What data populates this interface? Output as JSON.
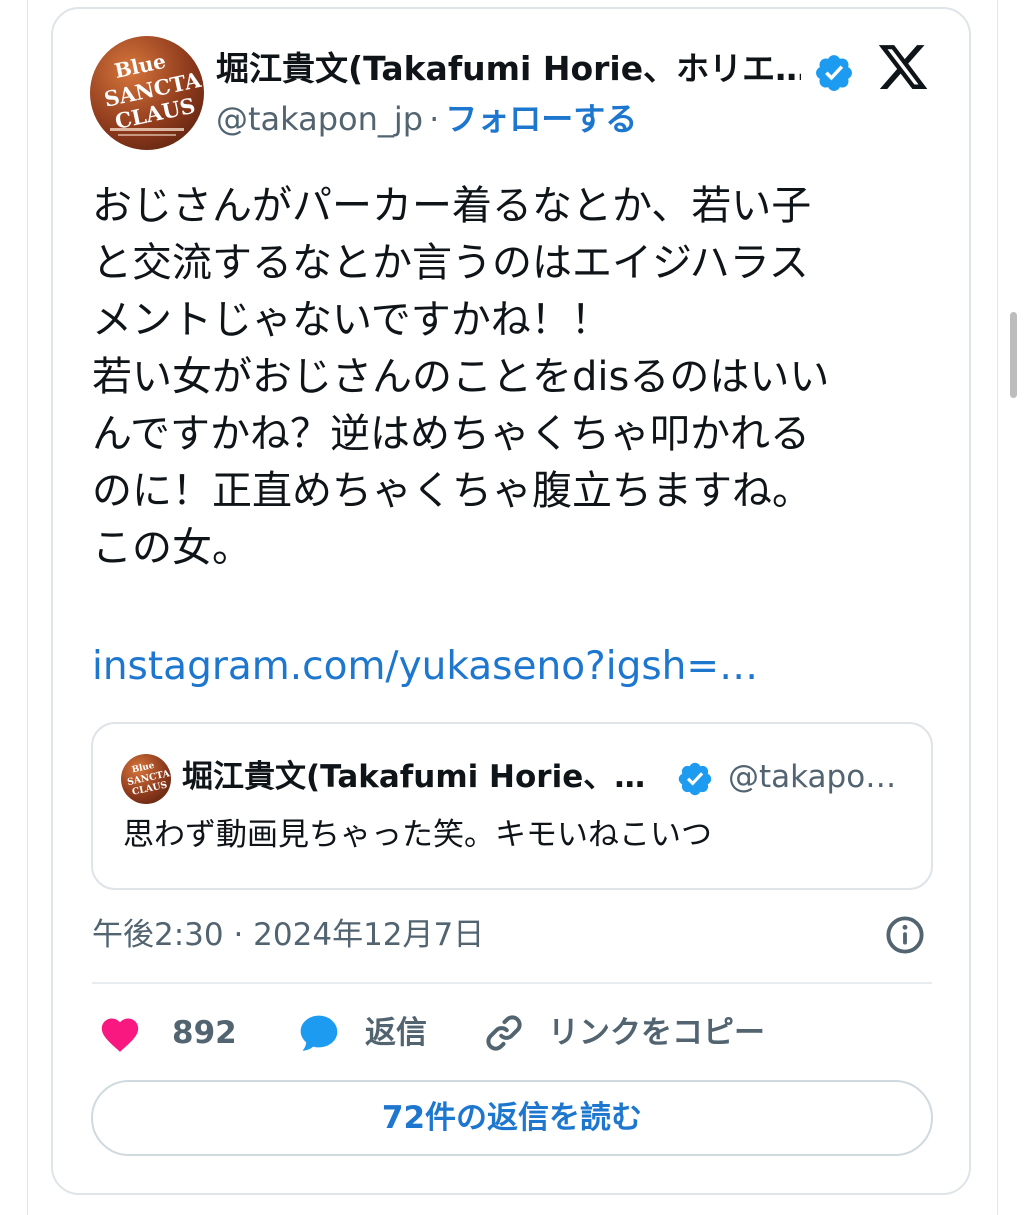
{
  "tweet": {
    "author_name": "堀江貴文(Takafumi Horie、ホリエ…",
    "handle": "@takapon_jp",
    "separator": "·",
    "follow_label": "フォローする",
    "body_lines": [
      "おじさんがパーカー着るなとか、若い子",
      "と交流するなとか言うのはエイジハラス",
      "メントじゃないですかね！！",
      "若い女がおじさんのことをdisるのはいい",
      "んですかね？逆はめちゃくちゃ叩かれる",
      "のに！正直めちゃくちゃ腹立ちますね。",
      "この女。"
    ],
    "link_text": "instagram.com/yukaseno?igsh=…",
    "timestamp": "午後2:30 · 2024年12月7日"
  },
  "quote": {
    "author_name": "堀江貴文(Takafumi Horie、…",
    "handle": "@takapo…",
    "text": "思わず動画見ちゃった笑。キモいねこいつ"
  },
  "avatar": {
    "logo_text_lines": [
      "Blue",
      "SANCTA",
      "CLAUS"
    ]
  },
  "actions": {
    "like_count": "892",
    "reply_label": "返信",
    "copy_link_label": "リンクをコピー",
    "read_replies_label": "72件の返信を読む"
  },
  "colors": {
    "link": "#1d77cf",
    "verified": "#1d9bf0",
    "like": "#f91880",
    "reply_bubble": "#1d9bf0",
    "muted": "#536471"
  },
  "icons": {
    "brand": "x-logo-icon",
    "verified": "verified-badge-icon",
    "info": "info-icon",
    "like": "heart-icon",
    "reply": "speech-bubble-icon",
    "copy": "link-icon"
  }
}
